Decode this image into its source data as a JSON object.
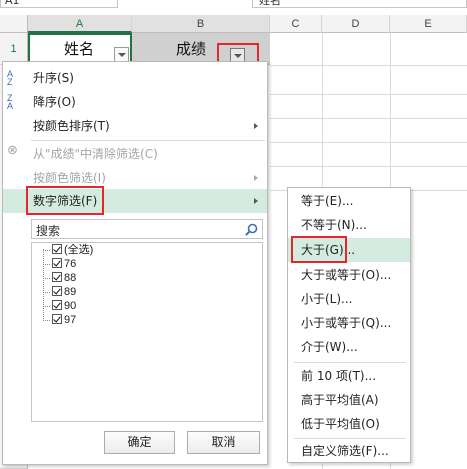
{
  "formula_bar": {
    "name_box": "A1",
    "content": "姓名"
  },
  "columns": [
    "A",
    "B",
    "C",
    "D",
    "E"
  ],
  "rows": [
    "1"
  ],
  "header_cells": {
    "a1": "姓名",
    "b1": "成绩"
  },
  "filter_menu": {
    "sort_asc": "升序(S)",
    "sort_desc": "降序(O)",
    "sort_by_color": "按颜色排序(T)",
    "clear_filter": "从\"成绩\"中清除筛选(C)",
    "filter_by_color": "按颜色筛选(I)",
    "number_filter": "数字筛选(F)",
    "search_placeholder": "搜索",
    "values": [
      {
        "label": "(全选)",
        "checked": true
      },
      {
        "label": "76",
        "checked": true
      },
      {
        "label": "88",
        "checked": true
      },
      {
        "label": "89",
        "checked": true
      },
      {
        "label": "90",
        "checked": true
      },
      {
        "label": "97",
        "checked": true
      }
    ],
    "ok": "确定",
    "cancel": "取消"
  },
  "number_filter_submenu": {
    "items": [
      "等于(E)...",
      "不等于(N)...",
      "大于(G)...",
      "大于或等于(O)...",
      "小于(L)...",
      "小于或等于(Q)...",
      "介于(W)...",
      "前 10 项(T)...",
      "高于平均值(A)",
      "低于平均值(O)",
      "自定义筛选(F)..."
    ],
    "highlighted_index": 2
  },
  "colors": {
    "accent_green": "#217346",
    "highlight": "#d3ecdf",
    "annotation_red": "#e0282e"
  }
}
